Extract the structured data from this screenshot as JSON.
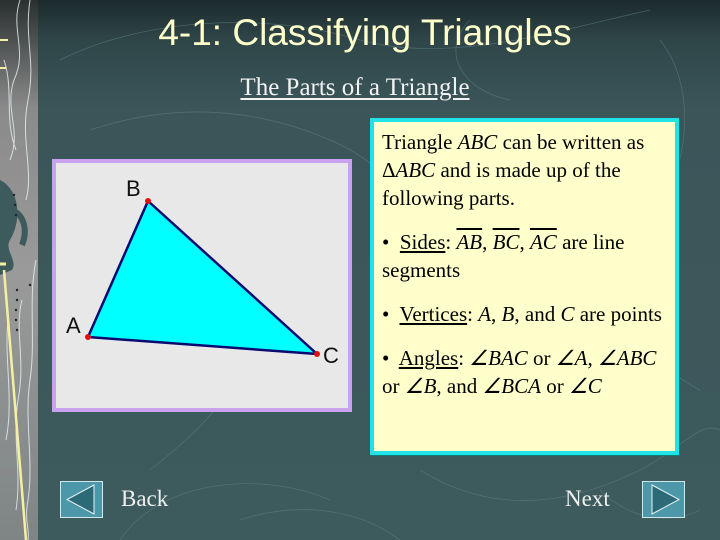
{
  "slide": {
    "title": "4-1: Classifying Triangles",
    "subtitle": "The Parts of a Triangle"
  },
  "figure": {
    "description": "Triangle ABC diagram",
    "vertex_labels": {
      "A": "A",
      "B": "B",
      "C": "C"
    },
    "colors": {
      "fill": "#00ffff",
      "stroke": "#0a0a70",
      "vertex": "#e01010",
      "frame": "#c8a2ee",
      "background": "#e8e8e8"
    }
  },
  "textbox": {
    "intro": {
      "t1": "Triangle ",
      "abc": "ABC",
      "t2": " can be written as ",
      "delta": "Δ",
      "abc2": "ABC",
      "t3": " and is made up of the following parts."
    },
    "sides": {
      "bullet": "•",
      "label": "Sides",
      "colon": ":  ",
      "segments": [
        "AB",
        "BC",
        "AC"
      ],
      "sep": ", ",
      "tail": " are line segments"
    },
    "vertices": {
      "bullet": "•",
      "label": "Vertices",
      "colon": ": ",
      "a": "A",
      "sep1": ", ",
      "b": "B",
      "sep2": ", and  ",
      "c": "C",
      "tail": " are points"
    },
    "angles": {
      "bullet": "•",
      "label": "Angles",
      "colon": ":  ",
      "items": [
        {
          "angle": "∠BAC",
          "or": " or ",
          "short": "∠A",
          "sep": ", "
        },
        {
          "angle": "∠ABC",
          "or": " or ",
          "short": "∠B",
          "sep": ", and "
        },
        {
          "angle": "∠BCA",
          "or": " or ",
          "short": "∠C",
          "sep": ""
        }
      ]
    },
    "colors": {
      "border": "#1fe3e6",
      "fill": "#ffffcc"
    }
  },
  "nav": {
    "back_label": "Back",
    "next_label": "Next",
    "back_icon": "triangle-left-icon",
    "next_icon": "triangle-right-icon"
  },
  "theme": {
    "background": "#3d5a5d",
    "title_color": "#ffffcc",
    "button_fill": "#4c98a8"
  }
}
